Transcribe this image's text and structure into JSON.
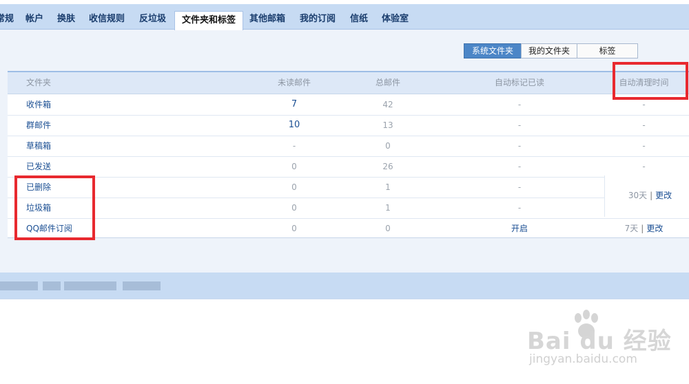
{
  "tabs": [
    {
      "label": "常规"
    },
    {
      "label": "帐户"
    },
    {
      "label": "换肤"
    },
    {
      "label": "收信规则"
    },
    {
      "label": "反垃圾"
    },
    {
      "label": "文件夹和标签"
    },
    {
      "label": "其他邮箱"
    },
    {
      "label": "我的订阅"
    },
    {
      "label": "信纸"
    },
    {
      "label": "体验室"
    }
  ],
  "active_tab": "文件夹和标签",
  "subtabs": [
    {
      "label": "系统文件夹"
    },
    {
      "label": "我的文件夹"
    },
    {
      "label": "标签"
    }
  ],
  "table": {
    "headers": [
      "文件夹",
      "未读邮件",
      "总邮件",
      "自动标记已读",
      "自动清理时间"
    ],
    "rows": [
      {
        "name": "收件箱",
        "unread": "7",
        "total": "42",
        "auto_read": "-",
        "auto_clean": "-"
      },
      {
        "name": "群邮件",
        "unread": "10",
        "total": "13",
        "auto_read": "-",
        "auto_clean": "-"
      },
      {
        "name": "草稿箱",
        "unread": "-",
        "total": "0",
        "auto_read": "-",
        "auto_clean": "-"
      },
      {
        "name": "已发送",
        "unread": "0",
        "total": "26",
        "auto_read": "-",
        "auto_clean": "-"
      },
      {
        "name": "已删除",
        "unread": "0",
        "total": "1",
        "auto_read": "-",
        "auto_clean": ""
      },
      {
        "name": "垃圾箱",
        "unread": "0",
        "total": "1",
        "auto_read": "-",
        "auto_clean": ""
      },
      {
        "name": "QQ邮件订阅",
        "unread": "0",
        "total": "0",
        "auto_read": "开启",
        "auto_clean": "7天"
      }
    ],
    "merged_clean": "30天",
    "separator": "|",
    "change_label": "更改"
  },
  "watermark": {
    "brand": "Bai du 经验",
    "url": "jingyan.baidu.com"
  },
  "colors": {
    "tab_bar": "#c7dbf3",
    "accent_blue": "#4c86c7",
    "link": "#1b4f93",
    "highlight_red": "#e8292f"
  }
}
